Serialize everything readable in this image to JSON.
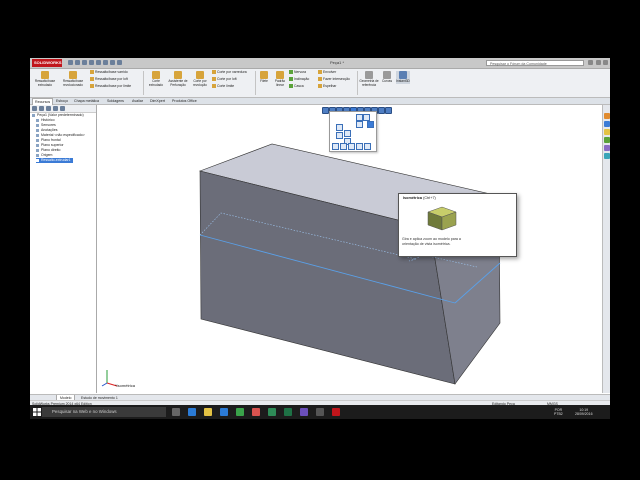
{
  "window": {
    "app_name": "SOLIDWORKS",
    "doc_title": "Peça1 *",
    "search_placeholder": "Pesquisar o Fórum da Comunidade"
  },
  "ribbon": {
    "big_buttons": [
      {
        "label": "Ressalto/base extrudado"
      },
      {
        "label": "Ressalto/base revolucionado"
      },
      {
        "label": "Corte extrudado"
      },
      {
        "label": "Assistente de Perfuração"
      },
      {
        "label": "Corte por revolução"
      },
      {
        "label": "Filete"
      },
      {
        "label": "Padrão linear"
      },
      {
        "label": "Geometria de referência"
      },
      {
        "label": "Curvas"
      },
      {
        "label": "Instant3D"
      }
    ],
    "small_buttons": [
      {
        "label": "Ressalto/base varrido"
      },
      {
        "label": "Ressalto/base por loft"
      },
      {
        "label": "Ressalto/base por limite"
      },
      {
        "label": "Corte por varredura"
      },
      {
        "label": "Corte por loft"
      },
      {
        "label": "Corte limite"
      },
      {
        "label": "Nervura"
      },
      {
        "label": "Inclinação"
      },
      {
        "label": "Casca"
      },
      {
        "label": "Envolver"
      },
      {
        "label": "Fazer intersecção"
      },
      {
        "label": "Espelhar"
      }
    ]
  },
  "tabs": [
    "Recursos",
    "Esboço",
    "Chapa metálica",
    "Soldagens",
    "Avaliar",
    "DimXpert",
    "Produtos Office"
  ],
  "tree": {
    "items": [
      {
        "label": "Peça1 (Valor predeterminado)"
      },
      {
        "label": "Histórico"
      },
      {
        "label": "Sensores"
      },
      {
        "label": "Anotações"
      },
      {
        "label": "Material <não especificado>"
      },
      {
        "label": "Plano frontal"
      },
      {
        "label": "Plano superior"
      },
      {
        "label": "Plano direito"
      },
      {
        "label": "Origem"
      },
      {
        "label": "Ressalto-extrudar1"
      }
    ]
  },
  "tooltip": {
    "title": "Isométrica",
    "shortcut": "(Ctrl+7)",
    "text": "Gira e aplica zoom ao modelo para a orientação de vista isométrica."
  },
  "viewport": {
    "view_label": "*Isométrica"
  },
  "bottom_tabs": [
    "Modelo",
    "Estudo de movimento 1"
  ],
  "status": {
    "left": "SolidWorks Premium 2014 x64 Edition",
    "mode": "Editando Peça",
    "units": "MMGS"
  },
  "taskbar": {
    "search_placeholder": "Pesquisar na Web e no Windows",
    "language": "POR",
    "layout": "PTB2",
    "time": "10:19",
    "date": "28/09/2016"
  },
  "colors": {
    "accent": "#3b7bd6",
    "brand": "#c0151b",
    "box_front": "#6b6d79",
    "box_top": "#c9cbd6",
    "box_side": "#7e808d",
    "edge_highlight": "#5aa0e8"
  }
}
